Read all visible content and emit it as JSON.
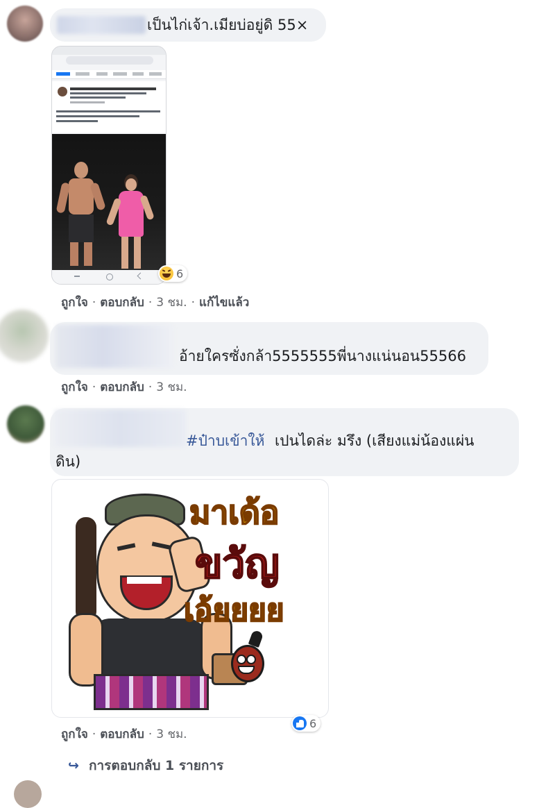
{
  "comments": [
    {
      "text": "เป็นไก่เจ้า.เมียบ่อยู่ดิ 55×",
      "actions": {
        "like": "ถูกใจ",
        "reply": "ตอบกลับ",
        "time": "3 ชม.",
        "edited": "แก้ไขแล้ว"
      },
      "reaction_count": "6",
      "reaction_icon": "haha-emoji-icon"
    },
    {
      "text": "อ้ายใครซั่งกล้า5555555พี่นางแน่นอน55566",
      "actions": {
        "like": "ถูกใจ",
        "reply": "ตอบกลับ",
        "time": "3 ชม."
      }
    },
    {
      "hashtag": "#ป๋าบเข้าให้",
      "text": "เปนไดล่ะ มรึง (เสียงแม่น้องแผ่นดิน)",
      "sticker_text": [
        "มาเด้อ",
        "ขวัญ",
        "เอ้ยยยย"
      ],
      "actions": {
        "like": "ถูกใจ",
        "reply": "ตอบกลับ",
        "time": "3 ชม."
      },
      "reaction_count": "6",
      "reaction_icon": "like-thumb-icon"
    }
  ],
  "replies_link": "การตอบกลับ 1 รายการ",
  "colors": {
    "bubble": "#f0f2f5",
    "link": "#385898",
    "like_blue": "#1877f2",
    "haha_yellow": "#f7c948"
  }
}
